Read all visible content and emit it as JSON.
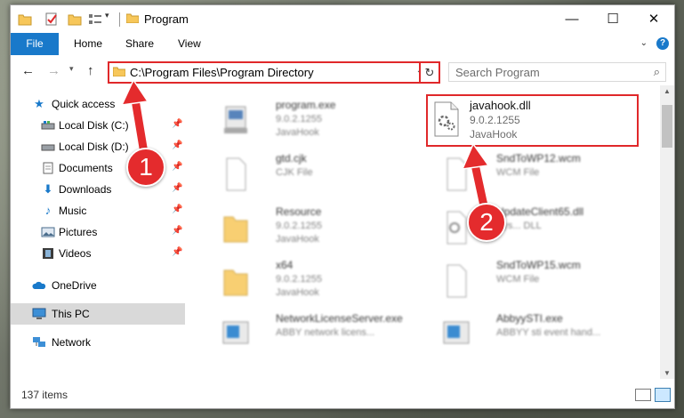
{
  "window": {
    "title": "Program",
    "controls": {
      "minimize": "—",
      "maximize": "☐",
      "close": "✕"
    }
  },
  "ribbon": {
    "tabs": [
      "File",
      "Home",
      "Share",
      "View"
    ],
    "help": "?"
  },
  "address": {
    "path": "C:\\Program Files\\Program Directory",
    "search_placeholder": "Search Program"
  },
  "nav_pane": {
    "items": [
      {
        "label": "Quick access",
        "icon": "star-icon"
      },
      {
        "label": "Local Disk (C:)",
        "icon": "drive-icon"
      },
      {
        "label": "Local Disk (D:)",
        "icon": "drive-icon"
      },
      {
        "label": "Documents",
        "icon": "documents-icon"
      },
      {
        "label": "Downloads",
        "icon": "download-icon"
      },
      {
        "label": "Music",
        "icon": "music-icon"
      },
      {
        "label": "Pictures",
        "icon": "pictures-icon"
      },
      {
        "label": "Videos",
        "icon": "videos-icon"
      },
      {
        "label": "OneDrive",
        "icon": "cloud-icon"
      },
      {
        "label": "This PC",
        "icon": "computer-icon"
      },
      {
        "label": "Network",
        "icon": "network-icon"
      }
    ]
  },
  "files": {
    "left": [
      {
        "name": "program.exe",
        "line2": "9.0.2.1255",
        "line3": "JavaHook"
      },
      {
        "name": "gtd.cjk",
        "line2": "CJK File",
        "line3": ""
      },
      {
        "name": "Resource",
        "line2": "9.0.2.1255",
        "line3": "JavaHook"
      },
      {
        "name": "x64",
        "line2": "9.0.2.1255",
        "line3": "JavaHook"
      },
      {
        "name": "NetworkLicenseServer.exe",
        "line2": "ABBY network licens...",
        "line3": ""
      }
    ],
    "right": [
      {
        "name": "javahook.dll",
        "line2": "9.0.2.1255",
        "line3": "JavaHook"
      },
      {
        "name": "SndToWP12.wcm",
        "line2": "WCM File",
        "line3": ""
      },
      {
        "name": "UpdateClient65.dll",
        "line2": "Sys... DLL",
        "line3": ""
      },
      {
        "name": "SndToWP15.wcm",
        "line2": "WCM File",
        "line3": ""
      },
      {
        "name": "AbbyySTI.exe",
        "line2": "ABBYY sti event hand...",
        "line3": ""
      }
    ]
  },
  "status": {
    "count": "137 items"
  },
  "annotations": {
    "step1": "1",
    "step2": "2"
  },
  "colors": {
    "accent": "#1979ca",
    "highlight": "#e0282a",
    "folder": "#f7c75a"
  }
}
